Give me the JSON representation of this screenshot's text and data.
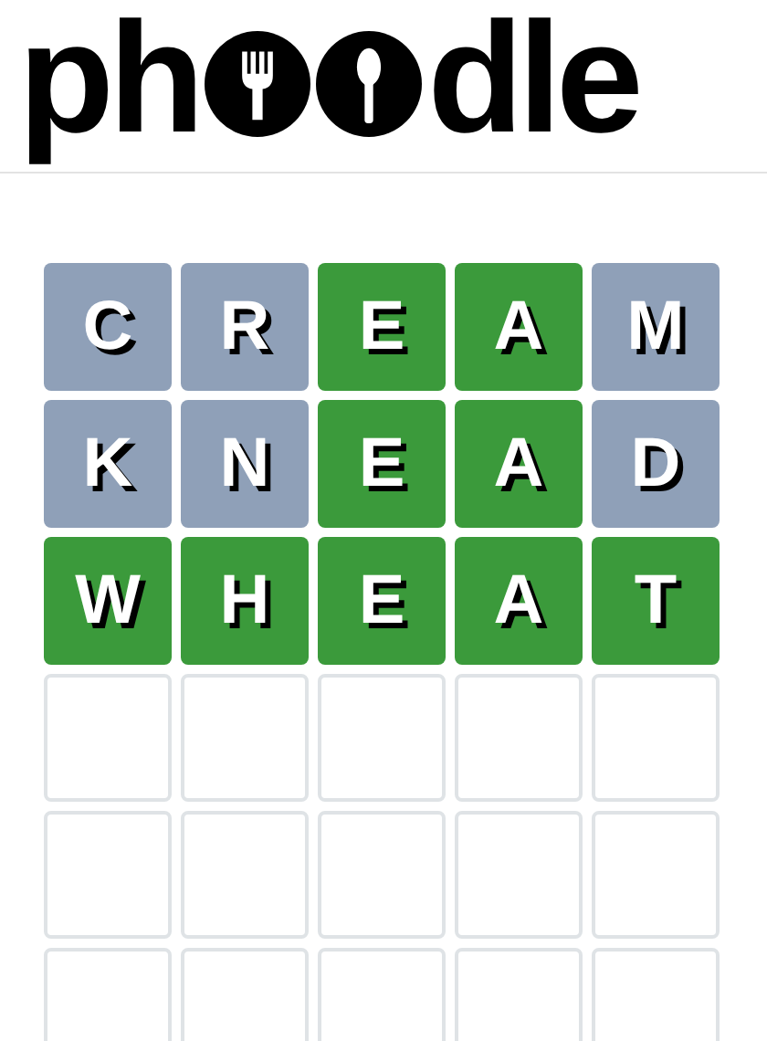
{
  "logo": {
    "start": "ph",
    "end": "dle"
  },
  "board": [
    {
      "tiles": [
        {
          "kind": "letter",
          "letter": "C",
          "color": "#8fa0b8"
        },
        {
          "kind": "letter",
          "letter": "R",
          "color": "#8fa0b8"
        },
        {
          "kind": "letter",
          "letter": "E",
          "color": "#3b9a3b"
        },
        {
          "kind": "letter",
          "letter": "A",
          "color": "#3b9a3b"
        },
        {
          "kind": "letter",
          "letter": "M",
          "color": "#8fa0b8"
        }
      ]
    },
    {
      "tiles": [
        {
          "kind": "letter",
          "letter": "K",
          "color": "#8fa0b8"
        },
        {
          "kind": "letter",
          "letter": "N",
          "color": "#8fa0b8"
        },
        {
          "kind": "letter",
          "letter": "E",
          "color": "#3b9a3b"
        },
        {
          "kind": "letter",
          "letter": "A",
          "color": "#3b9a3b"
        },
        {
          "kind": "letter",
          "letter": "D",
          "color": "#8fa0b8"
        }
      ]
    },
    {
      "tiles": [
        {
          "kind": "letter",
          "letter": "W",
          "color": "#3b9a3b"
        },
        {
          "kind": "letter",
          "letter": "H",
          "color": "#3b9a3b"
        },
        {
          "kind": "letter",
          "letter": "E",
          "color": "#3b9a3b"
        },
        {
          "kind": "letter",
          "letter": "A",
          "color": "#3b9a3b"
        },
        {
          "kind": "letter",
          "letter": "T",
          "color": "#3b9a3b"
        }
      ]
    },
    {
      "tiles": [
        {
          "kind": "blank"
        },
        {
          "kind": "blank"
        },
        {
          "kind": "blank"
        },
        {
          "kind": "blank"
        },
        {
          "kind": "blank"
        }
      ]
    },
    {
      "tiles": [
        {
          "kind": "blank"
        },
        {
          "kind": "blank"
        },
        {
          "kind": "blank"
        },
        {
          "kind": "blank"
        },
        {
          "kind": "blank"
        }
      ]
    },
    {
      "tiles": [
        {
          "kind": "blank"
        },
        {
          "kind": "blank"
        },
        {
          "kind": "blank"
        },
        {
          "kind": "blank"
        },
        {
          "kind": "blank"
        }
      ]
    }
  ]
}
